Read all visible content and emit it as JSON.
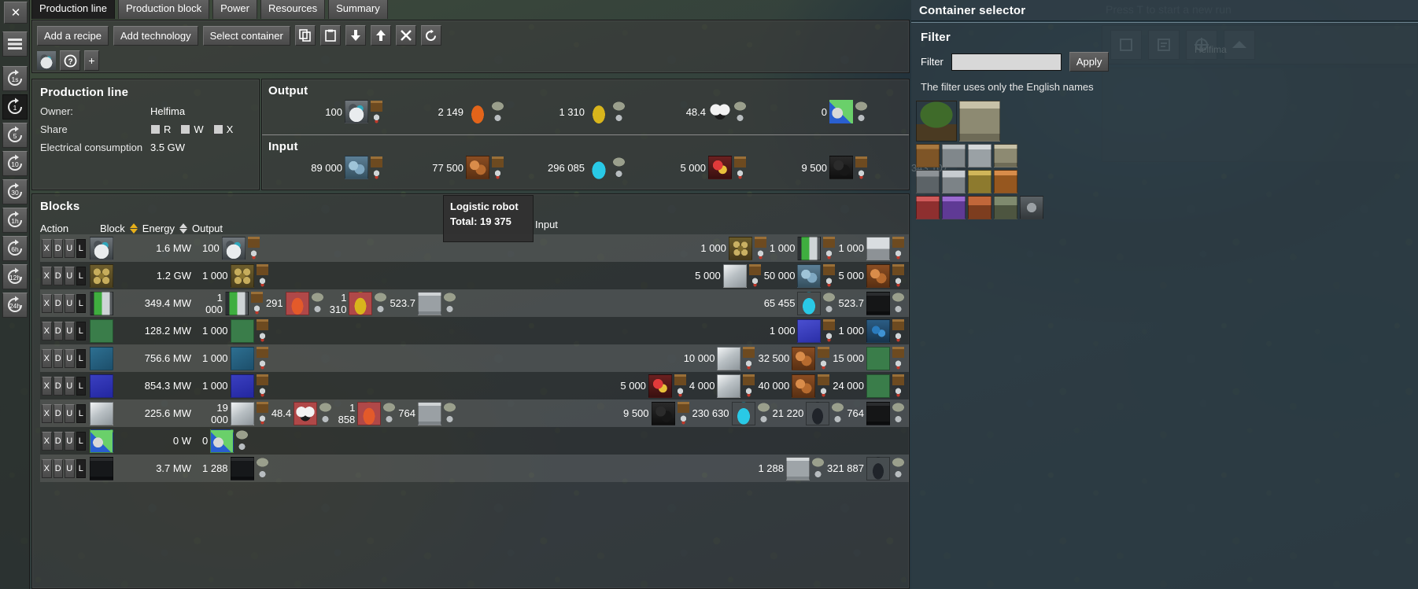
{
  "window": {
    "close_label": "✕",
    "tabs": [
      {
        "label": "Production line",
        "active": true
      },
      {
        "label": "Production block",
        "active": false
      },
      {
        "label": "Power",
        "active": false
      },
      {
        "label": "Resources",
        "active": false
      },
      {
        "label": "Summary",
        "active": false
      }
    ]
  },
  "rail": {
    "menu_icon": "hamburger-icon",
    "time_buttons": [
      "1s",
      "1",
      "5",
      "10",
      "30",
      "1h",
      "6h",
      "12h",
      "24h"
    ],
    "selected_time": "1"
  },
  "toolbar": {
    "add_recipe": "Add a recipe",
    "add_technology": "Add technology",
    "select_container": "Select container",
    "copy_icon": "copy-icon",
    "paste_icon": "paste-icon",
    "download_icon": "download-arrow-icon",
    "upload_icon": "upload-arrow-icon",
    "delete_icon": "close-x-icon",
    "refresh_icon": "refresh-icon",
    "help_icon": "question-mark-icon",
    "add_icon": "plus-icon"
  },
  "production_line": {
    "title": "Production line",
    "owner_label": "Owner:",
    "owner_value": "Helfima",
    "share_label": "Share",
    "share_options": [
      "R",
      "W",
      "X"
    ],
    "power_label": "Electrical consumption",
    "power_value": "3.5 GW"
  },
  "output": {
    "title": "Output",
    "items": [
      {
        "value": "100",
        "icon": "logistic-robot-icon",
        "color": "plain"
      },
      {
        "value": "2 149",
        "icon": "crude-oil-drop-icon",
        "color": "plain"
      },
      {
        "value": "1 310",
        "icon": "lubricant-drop-icon",
        "color": "plain"
      },
      {
        "value": "48.4",
        "icon": "plastic-molecule-icon",
        "color": "plain"
      },
      {
        "value": "0",
        "icon": "science-pack-icon",
        "color": "plain"
      }
    ]
  },
  "input": {
    "title": "Input",
    "items": [
      {
        "value": "89 000",
        "icon": "iron-ore-icon"
      },
      {
        "value": "77 500",
        "icon": "copper-ore-icon"
      },
      {
        "value": "296 085",
        "icon": "water-drop-icon"
      },
      {
        "value": "5 000",
        "icon": "raw-resource-icon"
      },
      {
        "value": "9 500",
        "icon": "coal-icon"
      },
      {
        "value": "343 107",
        "icon": "crude-oil-icon"
      }
    ]
  },
  "tooltip": {
    "title": "Logistic robot",
    "total_label": "Total:",
    "total_value": "19 375"
  },
  "blocks": {
    "title": "Blocks",
    "headers": {
      "action": "Action",
      "block": "Block",
      "energy": "Energy",
      "output": "Output",
      "input": "Input"
    },
    "block_sort_active": true,
    "action_buttons": [
      "X",
      "D",
      "U",
      "L"
    ],
    "rows": [
      {
        "block_icon": "logistic-robot-icon",
        "energy": "1.6 MW",
        "outputs": [
          {
            "value": "100",
            "icon": "logistic-robot-icon"
          }
        ],
        "inputs": [
          {
            "value": "1 000",
            "icon": "steel-gear-icon"
          },
          {
            "value": "1 000",
            "icon": "battery-icon"
          },
          {
            "value": "1 000",
            "icon": "electronic-board-icon"
          }
        ]
      },
      {
        "block_icon": "gear-wheel-icon",
        "energy": "1.2 GW",
        "outputs": [
          {
            "value": "1 000",
            "icon": "gear-wheel-icon"
          }
        ],
        "inputs": [
          {
            "value": "5 000",
            "icon": "iron-plate-icon"
          },
          {
            "value": "50 000",
            "icon": "iron-ore-icon"
          },
          {
            "value": "5 000",
            "icon": "copper-ore-icon"
          }
        ]
      },
      {
        "block_icon": "battery-icon",
        "energy": "349.4 MW",
        "outputs": [
          {
            "value": "1 000",
            "icon": "battery-icon"
          },
          {
            "value": "291",
            "icon": "sulfuric-acid-icon"
          },
          {
            "value": "1 310",
            "icon": "lubricant-drop-icon"
          },
          {
            "value": "523.7",
            "icon": "light-oil-barrel-icon"
          }
        ],
        "inputs": [
          {
            "value": "65 455",
            "icon": "water-drop-icon"
          },
          {
            "value": "523.7",
            "icon": "heavy-oil-barrel-icon"
          }
        ]
      },
      {
        "block_icon": "electronic-circuit-icon",
        "energy": "128.2 MW",
        "outputs": [
          {
            "value": "1 000",
            "icon": "electronic-circuit-icon"
          }
        ],
        "inputs": [
          {
            "value": "1 000",
            "icon": "circuit-board-icon"
          },
          {
            "value": "1 000",
            "icon": "copper-cable-icon"
          }
        ]
      },
      {
        "block_icon": "advanced-circuit-icon",
        "energy": "756.6 MW",
        "outputs": [
          {
            "value": "1 000",
            "icon": "advanced-circuit-icon"
          }
        ],
        "inputs": [
          {
            "value": "10 000",
            "icon": "iron-plate-icon"
          },
          {
            "value": "32 500",
            "icon": "copper-ore-icon"
          },
          {
            "value": "15 000",
            "icon": "electronic-circuit-icon"
          }
        ]
      },
      {
        "block_icon": "processing-unit-icon",
        "energy": "854.3 MW",
        "outputs": [
          {
            "value": "1 000",
            "icon": "processing-unit-icon"
          }
        ],
        "inputs": [
          {
            "value": "5 000",
            "icon": "raw-resource-icon"
          },
          {
            "value": "4 000",
            "icon": "iron-plate-icon"
          },
          {
            "value": "40 000",
            "icon": "copper-ore-icon"
          },
          {
            "value": "24 000",
            "icon": "electronic-circuit-icon"
          }
        ]
      },
      {
        "block_icon": "iron-plate-icon",
        "energy": "225.6 MW",
        "outputs": [
          {
            "value": "19 000",
            "icon": "iron-plate-icon"
          },
          {
            "value": "48.4",
            "icon": "plastic-molecule-icon"
          },
          {
            "value": "1 858",
            "icon": "sulfuric-acid-icon"
          },
          {
            "value": "764",
            "icon": "light-oil-barrel-icon"
          }
        ],
        "inputs": [
          {
            "value": "9 500",
            "icon": "coal-icon"
          },
          {
            "value": "230 630",
            "icon": "water-drop-icon"
          },
          {
            "value": "21 220",
            "icon": "crude-oil-icon"
          },
          {
            "value": "764",
            "icon": "heavy-oil-barrel-icon"
          }
        ]
      },
      {
        "block_icon": "science-pack-icon",
        "energy": "0 W",
        "outputs": [
          {
            "value": "0",
            "icon": "science-pack-icon"
          }
        ],
        "inputs": []
      },
      {
        "block_icon": "oil-barrel-icon",
        "energy": "3.7 MW",
        "outputs": [
          {
            "value": "1 288",
            "icon": "oil-barrel-icon"
          }
        ],
        "inputs": [
          {
            "value": "1 288",
            "icon": "empty-barrel-icon"
          },
          {
            "value": "321 887",
            "icon": "crude-oil-icon"
          }
        ]
      }
    ]
  },
  "container_selector": {
    "title": "Container selector",
    "filter_section": "Filter",
    "filter_label": "Filter",
    "filter_value": "",
    "filter_placeholder": "",
    "apply_label": "Apply",
    "note": "The filter uses only the English names",
    "palette_rows": [
      [
        "tree-icon",
        "storage-tank-icon"
      ],
      [
        "wooden-chest-icon",
        "iron-chest-icon",
        "steel-chest-icon",
        "storage-tank-icon"
      ],
      [
        "cargo-wagon-icon",
        "fluid-wagon-icon",
        "logistic-chest-passive-icon",
        "logistic-chest-active-icon"
      ],
      [
        "logistic-chest-requester-icon",
        "logistic-chest-buffer-icon",
        "car-icon",
        "tank-icon",
        "spidertron-icon"
      ]
    ]
  },
  "game_hud": {
    "new_run_hint": "Press T to start a new run",
    "map_label": "Helfima"
  }
}
